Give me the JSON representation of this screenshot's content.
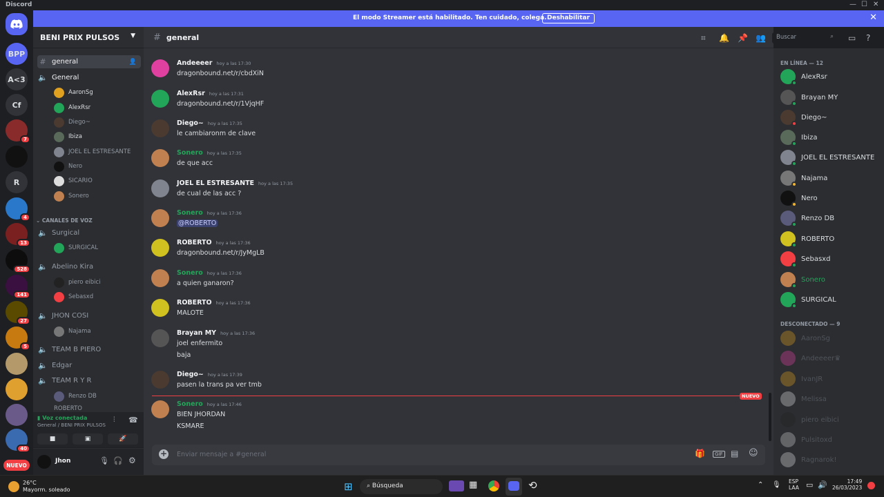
{
  "window": {
    "title": "Discord"
  },
  "streamer_banner": {
    "message": "El modo Streamer está habilitado. Ten cuidado, colega.",
    "button": "Deshabilitar"
  },
  "guilds": [
    {
      "label": "BPP",
      "badge": ""
    },
    {
      "label": "A<3",
      "badge": ""
    },
    {
      "label": "Cf",
      "badge": ""
    },
    {
      "label": "",
      "badge": "7"
    },
    {
      "label": "",
      "badge": ""
    },
    {
      "label": "R",
      "badge": ""
    },
    {
      "label": "",
      "badge": "4"
    },
    {
      "label": "",
      "badge": "13"
    },
    {
      "label": "",
      "badge": "528"
    },
    {
      "label": "",
      "badge": "141"
    },
    {
      "label": "",
      "badge": "27"
    },
    {
      "label": "",
      "badge": "5"
    },
    {
      "label": "",
      "badge": ""
    },
    {
      "label": "",
      "badge": ""
    },
    {
      "label": "",
      "badge": ""
    },
    {
      "label": "",
      "badge": "40"
    }
  ],
  "guild_new_label": "NUEVO",
  "server": {
    "name": "BENI PRIX PULSOS"
  },
  "channels": {
    "active_text": "general",
    "voice_general": "General",
    "general_users": [
      "AaronSg",
      "AlexRsr",
      "Diego~",
      "Ibiza",
      "JOEL EL ESTRESANTE",
      "Nero",
      "SICARIO",
      "Sonero"
    ],
    "voice_category": "CANALES DE VOZ",
    "surgical": "Surgical",
    "surgical_users": [
      "SURGICAL"
    ],
    "abelino": "Abelino Kira",
    "abelino_users": [
      "piero eibici",
      "Sebasxd"
    ],
    "jhon": "JHON COSI",
    "jhon_users": [
      "Najama"
    ],
    "team_piero": "TEAM B PIERO",
    "edgar": "Edgar",
    "team_ryr": "TEAM R Y R",
    "ryr_users": [
      "Renzo DB",
      "ROBERTO"
    ]
  },
  "voice_status": {
    "title": "Voz conectada",
    "subtitle": "General / BENI PRIX PULSOS"
  },
  "user": {
    "name": "Jhon"
  },
  "header": {
    "channel": "general",
    "search_placeholder": "Buscar"
  },
  "messages": [
    {
      "user": "Andeeeer",
      "time": "hoy a las 17:30",
      "lines": [
        "dragonbound.net/r/cbdXiN"
      ],
      "color": "#f2f3f5"
    },
    {
      "user": "AlexRsr",
      "time": "hoy a las 17:31",
      "lines": [
        "dragonbound.net/r/1VjqHF"
      ],
      "color": "#f2f3f5"
    },
    {
      "user": "Diego~",
      "time": "hoy a las 17:35",
      "lines": [
        "le cambiaronm de clave"
      ],
      "color": "#f2f3f5"
    },
    {
      "user": "Sonero",
      "time": "hoy a las 17:35",
      "lines": [
        "de que acc"
      ],
      "color": "#23a559"
    },
    {
      "user": "JOEL EL ESTRESANTE",
      "time": "hoy a las 17:35",
      "lines": [
        "de cual de las acc ?"
      ],
      "color": "#f2f3f5"
    },
    {
      "user": "Sonero",
      "time": "hoy a las 17:36",
      "lines": [
        "@ROBERTO"
      ],
      "color": "#23a559"
    },
    {
      "user": "ROBERTO",
      "time": "hoy a las 17:36",
      "lines": [
        "dragonbound.net/r/JyMgLB"
      ],
      "color": "#f2f3f5"
    },
    {
      "user": "Sonero",
      "time": "hoy a las 17:36",
      "lines": [
        "a quien ganaron?"
      ],
      "color": "#23a559"
    },
    {
      "user": "ROBERTO",
      "time": "hoy a las 17:36",
      "lines": [
        "MALOTE"
      ],
      "color": "#f2f3f5"
    },
    {
      "user": "Brayan MY",
      "time": "hoy a las 17:36",
      "lines": [
        "joel enfermito",
        "baja"
      ],
      "color": "#f2f3f5"
    },
    {
      "user": "Diego~",
      "time": "hoy a las 17:39",
      "lines": [
        "pasen la trans pa ver tmb"
      ],
      "color": "#f2f3f5"
    },
    {
      "user": "Sonero",
      "time": "hoy a las 17:46",
      "lines": [
        "BIEN JHORDAN",
        "KSMARE"
      ],
      "color": "#23a559"
    }
  ],
  "new_marker": "NUEVO",
  "input": {
    "placeholder": "Enviar mensaje a #general"
  },
  "members": {
    "online_header": "EN LÍNEA — 12",
    "online": [
      "AlexRsr",
      "Brayan MY",
      "Diego~",
      "Ibiza",
      "JOEL EL ESTRESANTE",
      "Najama",
      "Nero",
      "Renzo DB",
      "ROBERTO",
      "Sebasxd",
      "Sonero",
      "SURGICAL"
    ],
    "offline_header": "DESCONECTADO — 9",
    "offline": [
      "AaronSg",
      "Andeeeer",
      "IvanJR",
      "Melissa",
      "piero eibici",
      "Pulsitoxd",
      "Ragnarok!"
    ]
  },
  "taskbar": {
    "weather_temp": "26°C",
    "weather_desc": "Mayorm. soleado",
    "search": "Búsqueda",
    "lang1": "ESP",
    "lang2": "LAA",
    "time": "17:49",
    "date": "26/03/2023"
  }
}
